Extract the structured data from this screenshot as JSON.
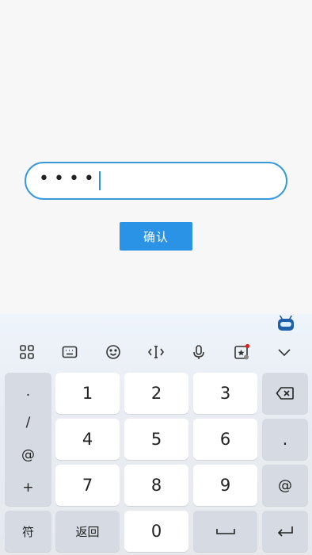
{
  "form": {
    "password_masked": "••••",
    "confirm_label": "确认"
  },
  "keyboard": {
    "toolbar_icons": [
      "apps-icon",
      "keyboard-icon",
      "emoji-icon",
      "cursor-move-icon",
      "microphone-icon",
      "sticker-icon",
      "collapse-chevron-icon"
    ],
    "side_symbols": [
      ".",
      "/",
      "@",
      "+"
    ],
    "digits": {
      "k1": "1",
      "k2": "2",
      "k3": "3",
      "k4": "4",
      "k5": "5",
      "k6": "6",
      "k7": "7",
      "k8": "8",
      "k9": "9",
      "k0": "0"
    },
    "right_keys": {
      "dot": ".",
      "at": "@"
    },
    "bottom": {
      "symbols": "符",
      "back": "返回"
    }
  },
  "colors": {
    "accent": "#2a93e6",
    "field_border": "#3a9ad9",
    "notify_dot": "#e02020"
  }
}
